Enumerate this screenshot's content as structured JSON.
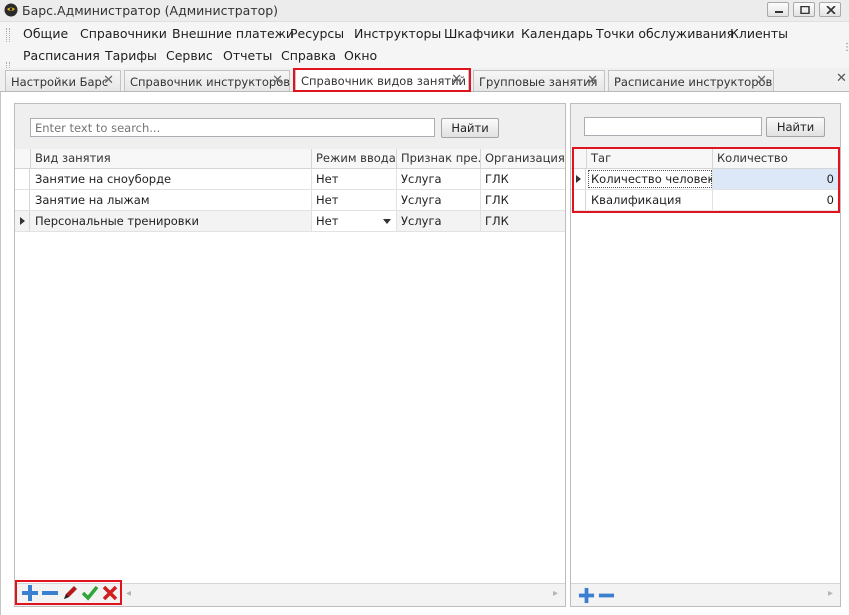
{
  "window": {
    "title": "Барс.Администратор (Администратор)"
  },
  "menu": {
    "row1": [
      "Общие",
      "Справочники",
      "Внешние платежи",
      "Ресурсы",
      "Инструкторы",
      "Шкафчики",
      "Календарь",
      "Точки обслуживания",
      "Клиенты"
    ],
    "row2": [
      "Расписания",
      "Тарифы",
      "Сервис",
      "Отчеты",
      "Справка",
      "Окно"
    ]
  },
  "tabs": [
    {
      "label": "Настройки Барс",
      "active": false
    },
    {
      "label": "Справочник инструкторов",
      "active": false
    },
    {
      "label": "Справочник видов занятий",
      "active": true
    },
    {
      "label": "Групповые занятия",
      "active": false
    },
    {
      "label": "Расписание инструкторов",
      "active": false
    }
  ],
  "left": {
    "search_placeholder": "Enter text to search...",
    "find_button": "Найти",
    "columns": [
      "Вид занятия",
      "Режим ввода...",
      "Признак пре...",
      "Организация"
    ],
    "rows": [
      [
        "Занятие на сноуборде",
        "Нет",
        "Услуга",
        "ГЛК"
      ],
      [
        "Занятие на лыжам",
        "Нет",
        "Услуга",
        "ГЛК"
      ],
      [
        "Персональные тренировки",
        "Нет",
        "Услуга",
        "ГЛК"
      ]
    ],
    "current_row_index": 2
  },
  "right": {
    "search_value": "",
    "find_button": "Найти",
    "columns": [
      "Таг",
      "Количество"
    ],
    "rows": [
      [
        "Количество человек",
        "0"
      ],
      [
        "Квалификация",
        "0"
      ]
    ],
    "current_row_index": 0
  },
  "colors": {
    "highlight": "#e0141e",
    "selected_cell": "#dce8f7",
    "add_icon": "#3a7fd0",
    "check_icon": "#2fa53a",
    "delete_icon": "#d11f1f"
  }
}
